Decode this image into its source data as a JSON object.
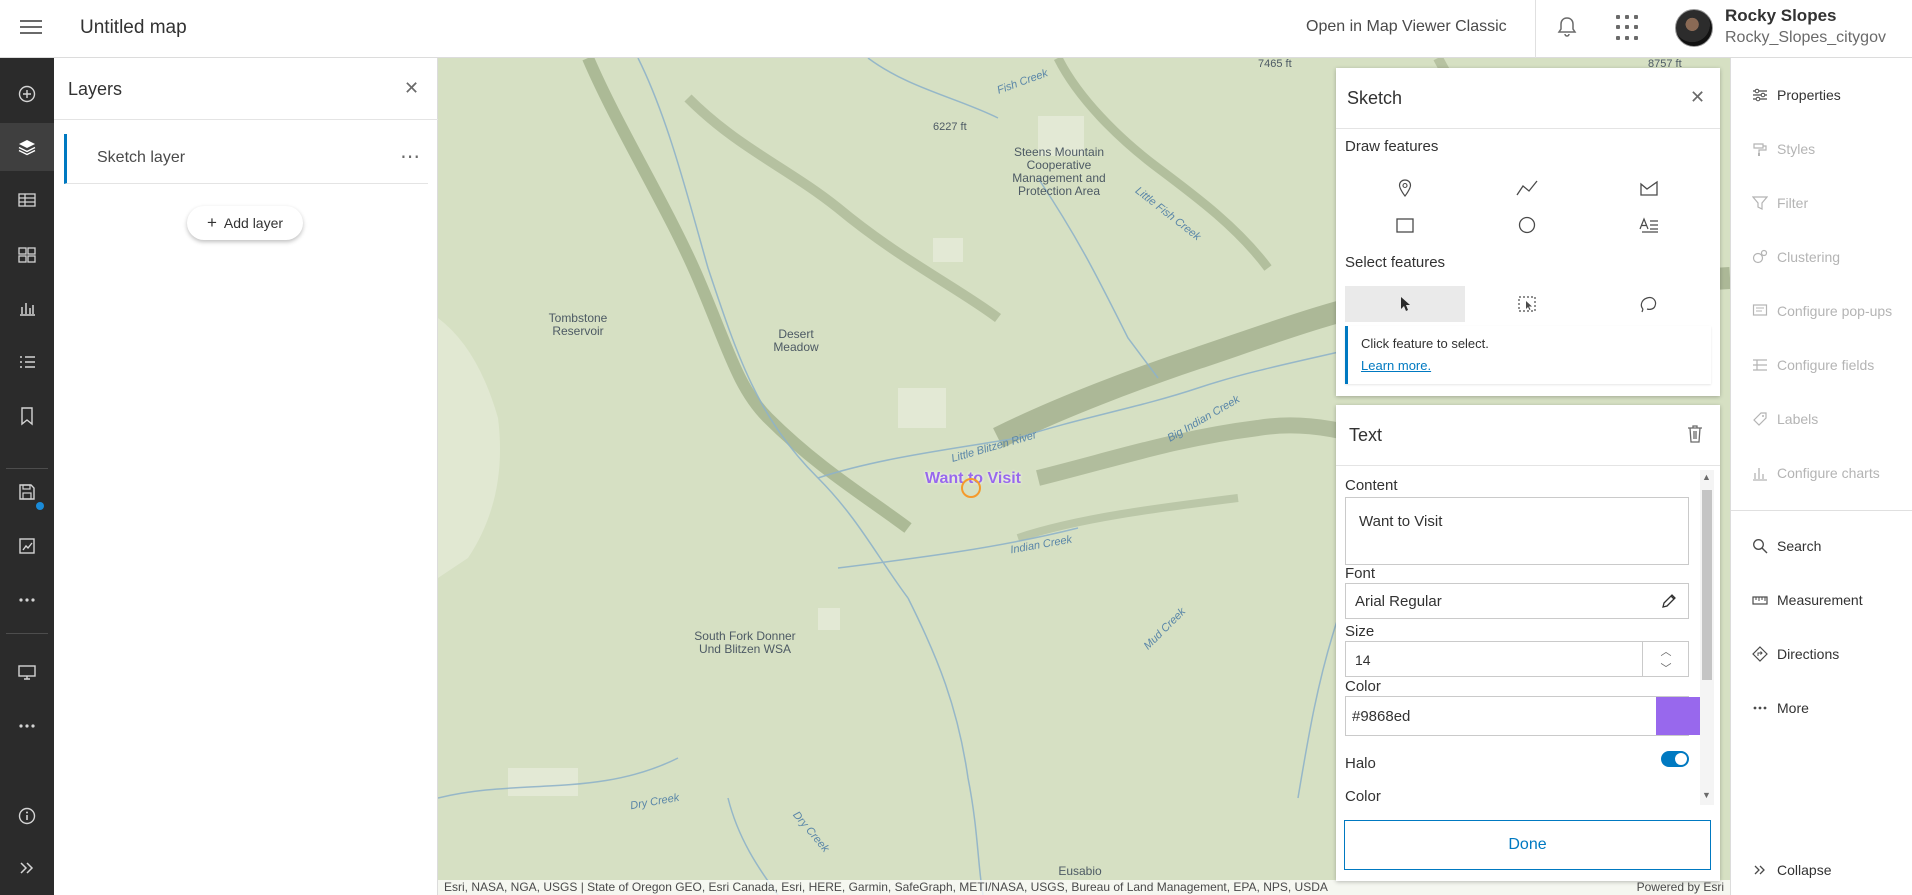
{
  "header": {
    "title": "Untitled map",
    "open_classic": "Open in Map Viewer Classic",
    "user_name": "Rocky Slopes",
    "user_id": "Rocky_Slopes_citygov"
  },
  "actionbar": {
    "items": [
      "add-icon",
      "layers-icon",
      "table-icon",
      "basemap-icon",
      "charts-icon",
      "legend-icon",
      "bookmarks-icon",
      "save-icon",
      "sketch-icon",
      "more-icon",
      "present-icon",
      "more-icon",
      "info-icon",
      "expand-icon"
    ]
  },
  "layers_panel": {
    "title": "Layers",
    "layer_name": "Sketch layer",
    "add_layer": "Add layer"
  },
  "map": {
    "labels": [
      {
        "text": "Steens Mountain Cooperative Management and Protection Area"
      },
      {
        "text": "Tombstone Reservoir"
      },
      {
        "text": "Desert Meadow"
      },
      {
        "text": "South Fork Donner Und Blitzen WSA"
      },
      {
        "text": "Eusabio"
      },
      {
        "text": "6227 ft"
      },
      {
        "text": "7465 ft"
      },
      {
        "text": "8757 ft"
      }
    ],
    "water_labels": [
      "Fish Creek",
      "Little Fish Creek",
      "Little Blitzen River",
      "Big Indian Creek",
      "Indian Creek",
      "Mud Creek",
      "Dry Creek",
      "Dry Creek"
    ],
    "sketch_text": "Want to Visit",
    "attribution": "Esri, NASA, NGA, USGS | State of Oregon GEO, Esri Canada, Esri, HERE, Garmin, SafeGraph, METI/NASA, USGS, Bureau of Land Management, EPA, NPS, USDA",
    "powered_by": "Powered by Esri"
  },
  "sketch_panel": {
    "title": "Sketch",
    "draw_label": "Draw features",
    "draw_tools": [
      "point-icon",
      "polyline-icon",
      "polygon-icon",
      "rectangle-icon",
      "circle-icon",
      "text-icon"
    ],
    "select_label": "Select features",
    "select_tools": [
      "pointer-select-icon",
      "rectangle-select-icon",
      "lasso-select-icon"
    ],
    "notice": "Click feature to select.",
    "learn_more": "Learn more."
  },
  "text_panel": {
    "title": "Text",
    "content_label": "Content",
    "content_value": "Want to Visit",
    "font_label": "Font",
    "font_value": "Arial Regular",
    "size_label": "Size",
    "size_value": "14",
    "color_label": "Color",
    "color_value": "#9868ed",
    "halo_label": "Halo",
    "halo_enabled": true,
    "halo_color_label": "Color",
    "done": "Done"
  },
  "rightbar": {
    "items": [
      {
        "label": "Properties",
        "icon": "properties-icon",
        "enabled": true
      },
      {
        "label": "Styles",
        "icon": "styles-icon",
        "enabled": false
      },
      {
        "label": "Filter",
        "icon": "filter-icon",
        "enabled": false
      },
      {
        "label": "Clustering",
        "icon": "clustering-icon",
        "enabled": false
      },
      {
        "label": "Configure pop-ups",
        "icon": "popups-icon",
        "enabled": false
      },
      {
        "label": "Configure fields",
        "icon": "fields-icon",
        "enabled": false
      },
      {
        "label": "Labels",
        "icon": "labels-icon",
        "enabled": false
      },
      {
        "label": "Configure charts",
        "icon": "charts-icon",
        "enabled": false
      },
      {
        "label": "Search",
        "icon": "search-icon",
        "enabled": true
      },
      {
        "label": "Measurement",
        "icon": "measurement-icon",
        "enabled": true
      },
      {
        "label": "Directions",
        "icon": "directions-icon",
        "enabled": true
      },
      {
        "label": "More",
        "icon": "more-icon",
        "enabled": true
      }
    ],
    "collapse": "Collapse"
  },
  "colors": {
    "accent": "#0079c1",
    "sketch_text": "#9868ed",
    "selection": "#f59a2b"
  }
}
